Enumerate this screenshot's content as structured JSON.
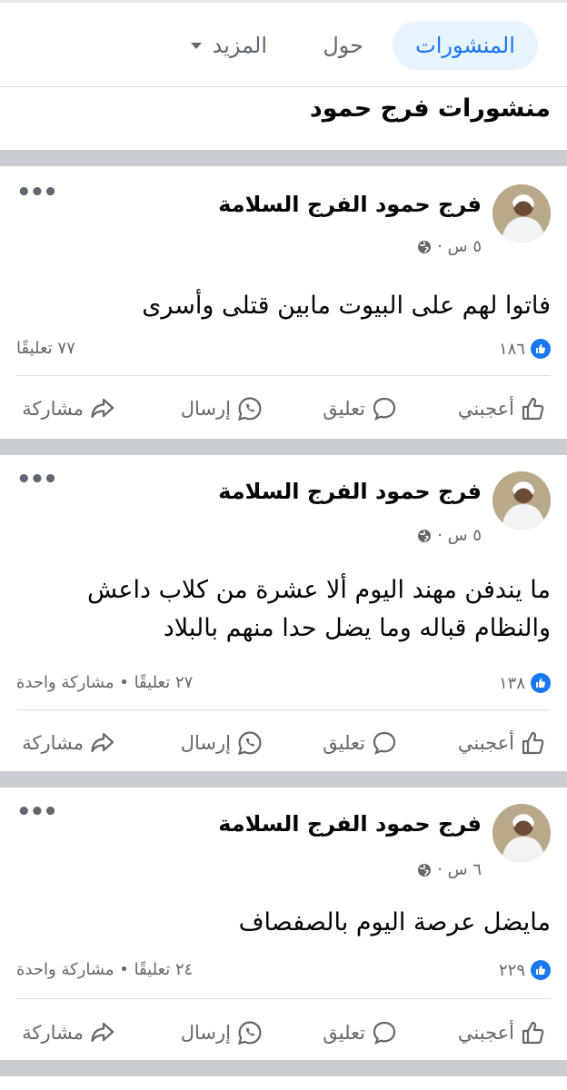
{
  "tabs": {
    "posts_label": "المنشورات",
    "about_label": "حول",
    "more_label": "المزيد"
  },
  "section_title": "منشورات فرج حمود",
  "posts": [
    {
      "author": "فرج حمود الفرج السلامة",
      "time": "٥ س ·",
      "text": "فاتوا لهم على البيوت مابين قتلى وأسرى",
      "likes": "١٨٦",
      "counts": "٧٧ تعليقًا"
    },
    {
      "author": "فرج حمود الفرج السلامة",
      "time": "٥ س ·",
      "text": "ما يندفن مهند اليوم ألا عشرة من كلاب داعش والنظام قباله وما يضل حدا منهم بالبلاد",
      "likes": "١٣٨",
      "counts": "٢٧ تعليقًا • مشاركة واحدة"
    },
    {
      "author": "فرج حمود الفرج السلامة",
      "time": "٦ س ·",
      "text": "مايضل عرصة اليوم بالصفصاف",
      "likes": "٢٢٩",
      "counts": "٢٤ تعليقًا • مشاركة واحدة"
    }
  ],
  "actions": {
    "like_label": "أعجبني",
    "comment_label": "تعليق",
    "send_label": "إرسال",
    "share_label": "مشاركة"
  },
  "colors": {
    "accent": "#1877f2",
    "tab_bg": "#e7f3ff",
    "separator": "#c9ccd1",
    "muted_text": "#65676b"
  },
  "icons": {
    "globe": "globe-icon",
    "like": "thumbs-up-icon",
    "comment": "comment-bubble-icon",
    "send": "whatsapp-icon",
    "share": "share-arrow-icon",
    "more": "more-dots-icon"
  }
}
